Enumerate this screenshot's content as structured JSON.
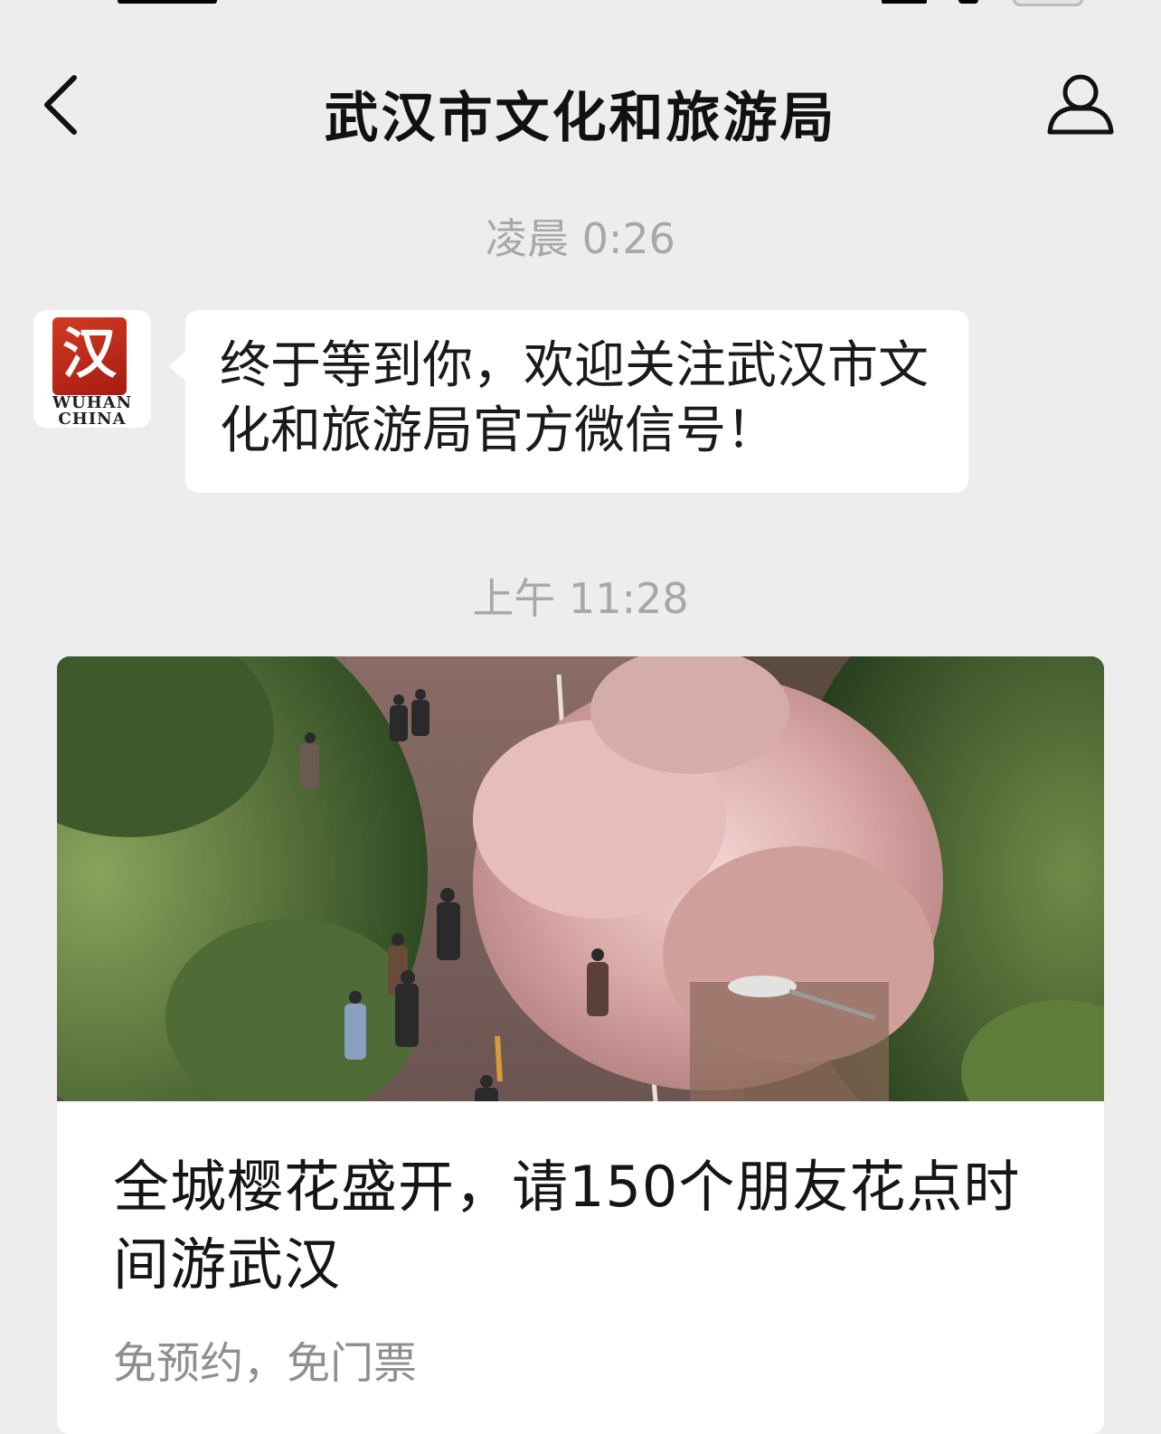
{
  "nav": {
    "title": "武汉市文化和旅游局"
  },
  "icons": {
    "back": "chevron-left-icon",
    "profile": "person-icon"
  },
  "messages": [
    {
      "timestamp": "凌晨 0:26",
      "sender_avatar": {
        "glyph": "汉",
        "brand_line1": "WUHAN",
        "brand_line2": "CHINA"
      },
      "text": "终于等到你，欢迎关注武汉市文化和旅游局官方微信号！"
    },
    {
      "timestamp": "上午 11:28",
      "article": {
        "headline": "全城樱花盛开，请150个朋友花点时间游武汉",
        "subtitle": "免预约，免门票"
      }
    }
  ],
  "colors": {
    "background": "#ededed",
    "bubble": "#ffffff",
    "seal_red": "#c0281a",
    "timestamp_gray": "#a8a8a8"
  }
}
